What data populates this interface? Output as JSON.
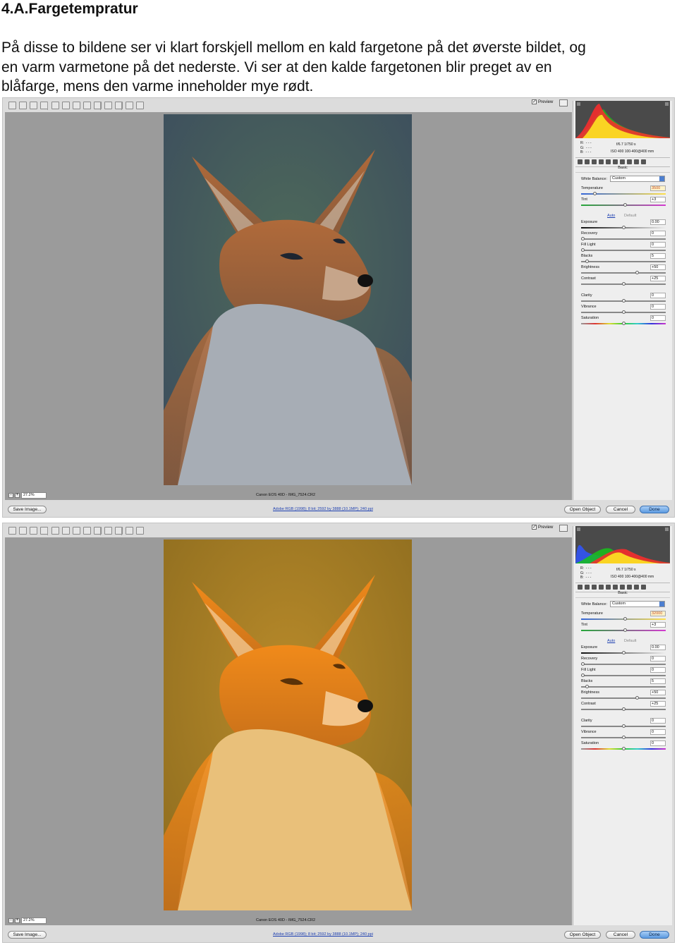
{
  "title": "4.A.Fargetempratur",
  "paragraph_lines": [
    "På disse to bildene ser vi klart forskjell mellom en kald fargetone på det øverste bildet, og",
    "en varm varmetone på det nederste. Vi ser at den kalde fargetonen blir preget av en",
    "blåfarge, mens den varme inneholder mye rødt."
  ],
  "screens": [
    {
      "preview_label": "Preview",
      "zoom": "27.2%",
      "camera_info": "Canon EOS 40D  -  IMG_7524.CR2",
      "workflow_link": "Adobe RGB (1998); 8 bit; 2592 by 3888 (10.1MP); 240 ppi",
      "buttons": {
        "save": "Save Image...",
        "open": "Open Object",
        "cancel": "Cancel",
        "done": "Done"
      },
      "rgb_readout": "R:  - - -\nG:  - - -\nB:  - - -",
      "exposure_info": "f/6.7   1/750 s",
      "iso_info": "ISO 400   100-400@400 mm",
      "panel_title": "Basic",
      "white_balance_label": "White Balance:",
      "white_balance_value": "Custom",
      "auto_label": "Auto",
      "default_label": "Default",
      "sliders": [
        {
          "label": "Temperature",
          "value": "3500"
        },
        {
          "label": "Tint",
          "value": "+3"
        },
        {
          "label": "Exposure",
          "value": "0.00"
        },
        {
          "label": "Recovery",
          "value": "0"
        },
        {
          "label": "Fill Light",
          "value": "0"
        },
        {
          "label": "Blacks",
          "value": "5"
        },
        {
          "label": "Brightness",
          "value": "+50"
        },
        {
          "label": "Contrast",
          "value": "+25"
        },
        {
          "label": "Clarity",
          "value": "0"
        },
        {
          "label": "Vibrance",
          "value": "0"
        },
        {
          "label": "Saturation",
          "value": "0"
        }
      ],
      "tone": "cool"
    },
    {
      "preview_label": "Preview",
      "zoom": "27.2%",
      "camera_info": "Canon EOS 40D  -  IMG_7524.CR2",
      "workflow_link": "Adobe RGB (1998); 8 bit; 2592 by 3888 (10.1MP); 240 ppi",
      "buttons": {
        "save": "Save Image...",
        "open": "Open Object",
        "cancel": "Cancel",
        "done": "Done"
      },
      "rgb_readout": "R:  - - -\nG:  - - -\nB:  - - -",
      "exposure_info": "f/6.7   1/750 s",
      "iso_info": "ISO 400   100-400@400 mm",
      "panel_title": "Basic",
      "white_balance_label": "White Balance:",
      "white_balance_value": "Custom",
      "auto_label": "Auto",
      "default_label": "Default",
      "sliders": [
        {
          "label": "Temperature",
          "value": "32000"
        },
        {
          "label": "Tint",
          "value": "+3"
        },
        {
          "label": "Exposure",
          "value": "0.00"
        },
        {
          "label": "Recovery",
          "value": "0"
        },
        {
          "label": "Fill Light",
          "value": "0"
        },
        {
          "label": "Blacks",
          "value": "5"
        },
        {
          "label": "Brightness",
          "value": "+50"
        },
        {
          "label": "Contrast",
          "value": "+25"
        },
        {
          "label": "Clarity",
          "value": "0"
        },
        {
          "label": "Vibrance",
          "value": "0"
        },
        {
          "label": "Saturation",
          "value": "0"
        }
      ],
      "tone": "warm"
    }
  ],
  "colors": {
    "cool_background": "#3a4a5e",
    "cool_fur": "#b06a3a",
    "warm_background": "#8a6a1e",
    "warm_fur": "#f08a1a",
    "done_button": "#5c9ae0"
  }
}
